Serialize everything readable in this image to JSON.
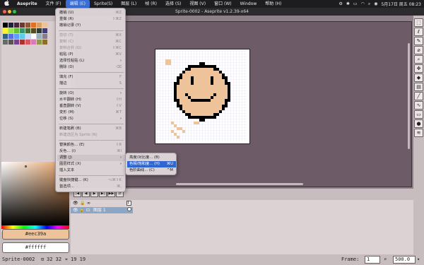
{
  "menubar": {
    "apple": "",
    "app": "Aseprite",
    "items": [
      "文件 (F)",
      "编辑 (E)",
      "Sprite(S)",
      "图层 (L)",
      "帧 (R)",
      "选择 (S)",
      "视图 (V)",
      "窗口 (W)",
      "Window",
      "帮助 (H)"
    ],
    "active_index": 1,
    "datetime": "5月17日 周五 08:23"
  },
  "window": {
    "title": "Sprite-0002 - Aseprite v1.2.39-x64"
  },
  "palette": {
    "colors": [
      "#000000",
      "#222034",
      "#45283c",
      "#663931",
      "#8f563b",
      "#df7126",
      "#d9a066",
      "#eec39a",
      "#fbf236",
      "#99e550",
      "#6abe30",
      "#37946e",
      "#4b692f",
      "#524b24",
      "#323c39",
      "#3f3f74",
      "#306082",
      "#5b6ee1",
      "#639bff",
      "#5fcde4",
      "#cbdbfc",
      "#ffffff",
      "#9badb7",
      "#847e87",
      "#696a6a",
      "#595652",
      "#76428a",
      "#ac3232",
      "#d95763",
      "#d77bba",
      "#8f974a",
      "#8a6f30"
    ],
    "foreground": "#eec39a",
    "background": "#ffffff"
  },
  "menu": {
    "items": [
      {
        "label": "撤销 (U)",
        "shortcut": "⌘Z",
        "disabled": false
      },
      {
        "label": "重做 (R)",
        "shortcut": "⇧⌘Z",
        "disabled": false
      },
      {
        "label": "撤销记录 (Y)",
        "shortcut": "",
        "disabled": false
      },
      {
        "sep": true
      },
      {
        "label": "剪切 (T)",
        "shortcut": "⌘X",
        "disabled": true
      },
      {
        "label": "复制 (C)",
        "shortcut": "⌘C",
        "disabled": true
      },
      {
        "label": "复制合并 (G)",
        "shortcut": "⇧⌘C",
        "disabled": true
      },
      {
        "label": "粘贴 (P)",
        "shortcut": "⌘V",
        "disabled": false
      },
      {
        "label": "选择性粘贴 (L)",
        "shortcut": "",
        "arrow": true,
        "disabled": false
      },
      {
        "label": "删除 (D)",
        "shortcut": "⌫",
        "disabled": false
      },
      {
        "sep": true
      },
      {
        "label": "填充 (F)",
        "shortcut": "F",
        "disabled": false
      },
      {
        "label": "描边",
        "shortcut": "S",
        "disabled": false
      },
      {
        "sep": true
      },
      {
        "label": "旋转 (O)",
        "shortcut": "",
        "arrow": true,
        "disabled": false
      },
      {
        "label": "水平翻转 (H)",
        "shortcut": "⇧H",
        "disabled": false
      },
      {
        "label": "垂直翻转 (V)",
        "shortcut": "⇧V",
        "disabled": false
      },
      {
        "label": "变形 (M)",
        "shortcut": "⌘T",
        "disabled": false
      },
      {
        "label": "位移 (S)",
        "shortcut": "",
        "arrow": true,
        "disabled": false
      },
      {
        "sep": true
      },
      {
        "label": "新建笔刷 (B)",
        "shortcut": "⌘B",
        "disabled": false
      },
      {
        "label": "新建选区为 Sprite (N)",
        "shortcut": "",
        "disabled": true
      },
      {
        "sep": true
      },
      {
        "label": "替换颜色... (E)",
        "shortcut": "⇧R",
        "disabled": false
      },
      {
        "label": "反色... (I)",
        "shortcut": "⌘I",
        "disabled": false
      },
      {
        "label": "调整 (J)",
        "shortcut": "",
        "arrow": true,
        "disabled": false,
        "highlight": true
      },
      {
        "label": "图层样式 (X)",
        "shortcut": "",
        "arrow": true,
        "disabled": false
      },
      {
        "label": "插入文本",
        "shortcut": "",
        "disabled": false
      },
      {
        "sep": true
      },
      {
        "label": "键盘快捷键... (K)",
        "shortcut": "⌥⌘⇧K",
        "disabled": false
      },
      {
        "label": "首选项...",
        "shortcut": "⌘,",
        "disabled": false
      }
    ]
  },
  "submenu": {
    "items": [
      {
        "label": "亮度/对比度... (B)",
        "shortcut": ""
      },
      {
        "label": "色相/饱和度... (H)",
        "shortcut": "⌘U",
        "selected": true
      },
      {
        "label": "色阶曲线... (C)",
        "shortcut": "^M"
      }
    ]
  },
  "timeline": {
    "layer_name": "图层 1",
    "frame_number": "1"
  },
  "status": {
    "sprite": "Sprite-0002",
    "size": "32 32",
    "pos": "19 19",
    "frame_label": "Frame:",
    "frame_value": "1",
    "zoom": "500.0"
  }
}
